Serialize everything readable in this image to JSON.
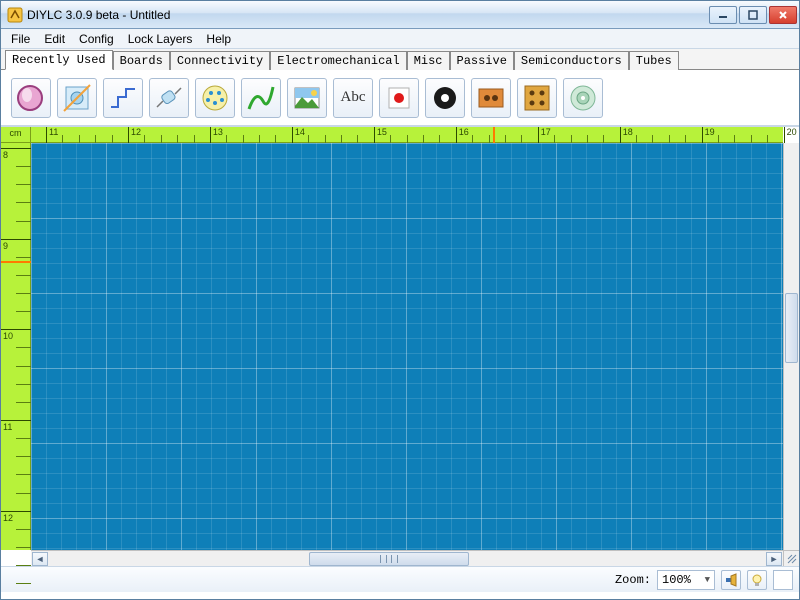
{
  "window": {
    "title": "DIYLC 3.0.9 beta - Untitled"
  },
  "menu": {
    "items": [
      "File",
      "Edit",
      "Config",
      "Lock Layers",
      "Help"
    ]
  },
  "tabs": {
    "items": [
      "Recently Used",
      "Boards",
      "Connectivity",
      "Electromechanical",
      "Misc",
      "Passive",
      "Semiconductors",
      "Tubes"
    ],
    "active_index": 0
  },
  "tools": [
    {
      "name": "solder-pad-tool"
    },
    {
      "name": "turret-board-tool"
    },
    {
      "name": "trace-tool"
    },
    {
      "name": "resistor-tool"
    },
    {
      "name": "ic-dip-tool"
    },
    {
      "name": "hookup-wire-tool"
    },
    {
      "name": "image-tool"
    },
    {
      "name": "label-tool",
      "label": "Abc"
    },
    {
      "name": "led-tool"
    },
    {
      "name": "eyelet-tool"
    },
    {
      "name": "perfboard-tool"
    },
    {
      "name": "breadboard-tool"
    },
    {
      "name": "cd-tool"
    }
  ],
  "ruler": {
    "unit": "cm",
    "h_start": 11,
    "h_labels": [
      "11",
      "12",
      "13",
      "14",
      "15",
      "16",
      "17",
      "18",
      "19",
      "20"
    ],
    "v_start": 8,
    "v_labels": [
      "8",
      "9",
      "10",
      "11",
      "12"
    ],
    "cursor_h_major": 16,
    "cursor_v_major": 9
  },
  "statusbar": {
    "zoom_label": "Zoom:",
    "zoom_value": "100%"
  }
}
